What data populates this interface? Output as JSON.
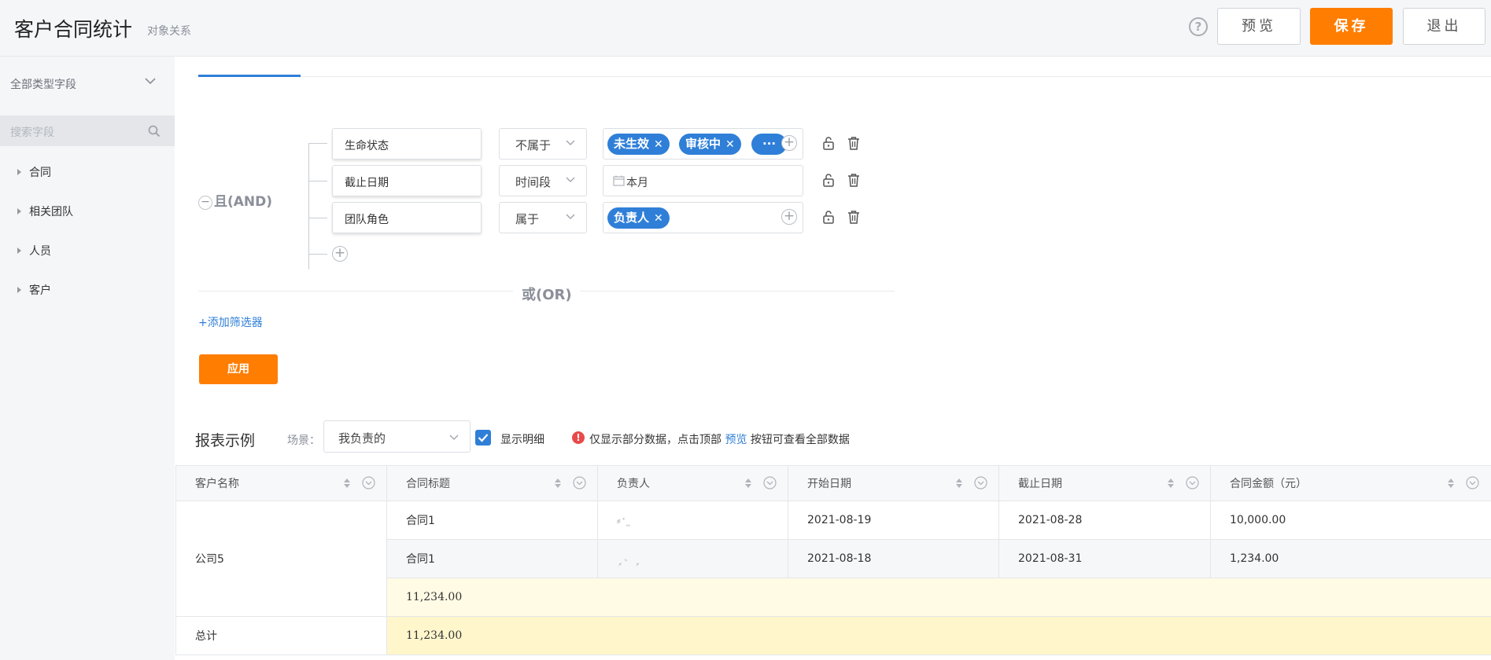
{
  "header": {
    "title": "客户合同统计",
    "subtitle": "对象关系",
    "help_glyph": "?",
    "preview_label": "预览",
    "save_label": "保存",
    "exit_label": "退出"
  },
  "sidebar": {
    "type_dropdown": "全部类型字段",
    "search_placeholder": "搜索字段",
    "items": [
      {
        "label": "合同"
      },
      {
        "label": "相关团队"
      },
      {
        "label": "人员"
      },
      {
        "label": "客户"
      }
    ]
  },
  "filter": {
    "group_minus": "−",
    "group_label": "且(AND)",
    "conditions": [
      {
        "field": "生命状态",
        "operator": "不属于",
        "tags": [
          "未生效",
          "审核中",
          "···"
        ]
      },
      {
        "field": "截止日期",
        "operator": "时间段",
        "value": "本月"
      },
      {
        "field": "团队角色",
        "operator": "属于",
        "tags": [
          "负责人"
        ]
      }
    ],
    "add_condition": "+",
    "tag_close": "✕",
    "tag_add": "+",
    "or_label": "或(OR)",
    "add_filter_label": "+添加筛选器",
    "apply_label": "应用"
  },
  "report": {
    "title": "报表示例",
    "scene_label": "场景：",
    "scene_value": "我负责的",
    "show_detail_label": "显示明细",
    "show_detail_checked": true,
    "warn_glyph": "!",
    "notice_prefix": "仅显示部分数据，点击顶部",
    "notice_link": "预览",
    "notice_suffix": "按钮可查看全部数据",
    "columns": [
      "客户名称",
      "合同标题",
      "负责人",
      "开始日期",
      "截止日期",
      "合同金额（元）"
    ],
    "group": {
      "customer": "公司5",
      "rows": [
        {
          "title": "合同1",
          "owner": "⸗ˑ ̤",
          "start": "2021-08-19",
          "end": "2021-08-28",
          "amount": "10,000.00"
        },
        {
          "title": "合同1",
          "owner": "ˏ˴ ˏ",
          "start": "2021-08-18",
          "end": "2021-08-31",
          "amount": "1,234.00"
        }
      ],
      "subtotal": "11,234.00"
    },
    "total_label": "总计",
    "total_amount": "11,234.00"
  },
  "colors": {
    "accent_orange": "#ff7d00",
    "accent_blue": "#2f7fd8"
  }
}
